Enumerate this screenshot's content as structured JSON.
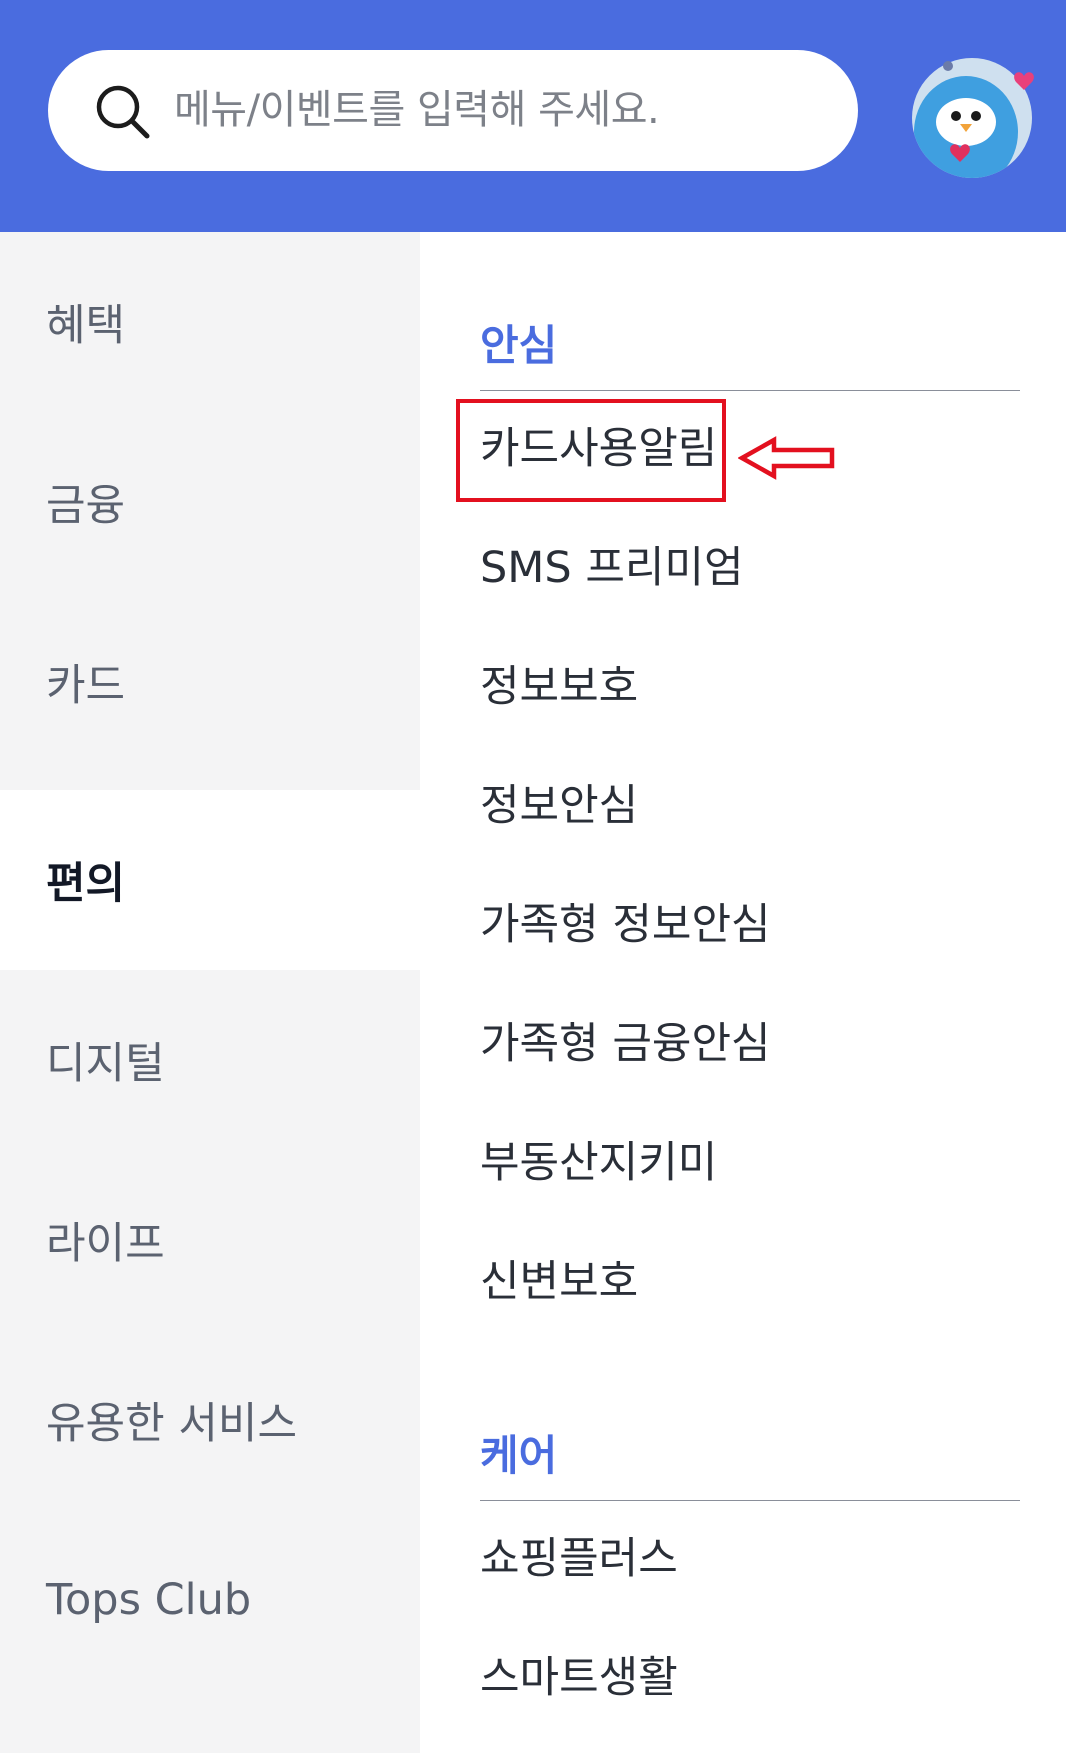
{
  "search": {
    "placeholder": "메뉴/이벤트를 입력해 주세요.",
    "icon": "search-icon"
  },
  "avatar": {
    "icon": "mascot-avatar"
  },
  "sidebar": {
    "items": [
      {
        "label": "혜택"
      },
      {
        "label": "금융"
      },
      {
        "label": "카드"
      },
      {
        "label": "편의",
        "active": true
      },
      {
        "label": "디지털"
      },
      {
        "label": "라이프"
      },
      {
        "label": "유용한 서비스"
      },
      {
        "label": "Tops Club"
      }
    ]
  },
  "content": {
    "sections": [
      {
        "title": "안심",
        "items": [
          "카드사용알림",
          "SMS 프리미엄",
          "정보보호",
          "정보안심",
          "가족형 정보안심",
          "가족형 금융안심",
          "부동산지키미",
          "신변보호"
        ]
      },
      {
        "title": "케어",
        "items": [
          "쇼핑플러스",
          "스마트생활"
        ]
      }
    ]
  },
  "annotation": {
    "highlight_color": "#e3101f",
    "arrow_icon": "left-arrow-icon"
  },
  "colors": {
    "brand": "#4a6cdf",
    "sidebar_bg": "#f4f4f5",
    "active_text": "#121826"
  }
}
